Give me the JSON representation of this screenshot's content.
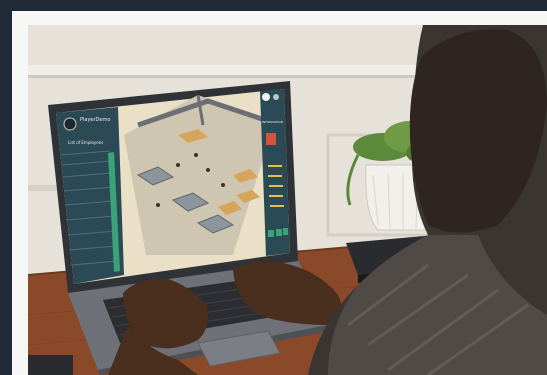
{
  "scene": {
    "subject": "person-using-laptop",
    "colors": {
      "page_background": "#1f2a36",
      "frame": "#f6f6f4",
      "wall": "#e7e3dc",
      "desk": "#8a4a2a",
      "laptop_body": "#3a3d42",
      "screen_panel": "#2c4a55",
      "accent_green": "#3aa37a"
    }
  },
  "game_screen": {
    "player_name": "PlayerDemo",
    "panel_title": "List of Employees",
    "side_title": "INFORMATION",
    "icons": [
      "avatar-icon",
      "chat-icon",
      "gear-icon",
      "build-icon"
    ]
  }
}
